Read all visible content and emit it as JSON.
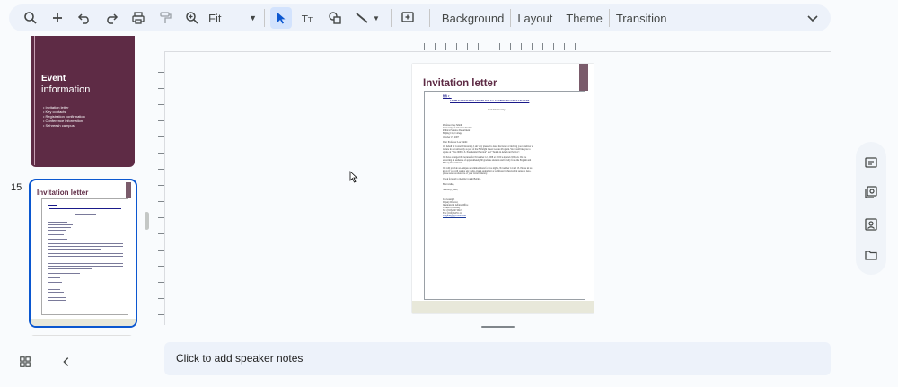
{
  "toolbar": {
    "icons": [
      "search-icon",
      "plus-icon",
      "undo-icon",
      "redo-icon",
      "print-icon",
      "paint-format-icon",
      "zoom-icon"
    ],
    "zoom_value": "Fit",
    "menu": {
      "background": "Background",
      "layout": "Layout",
      "theme": "Theme",
      "transition": "Transition"
    }
  },
  "filmstrip": {
    "previous_slide": {
      "title_bold": "Event",
      "title_light": "information",
      "bullets": [
        "Invitation letter",
        "Key contacts",
        "Registration confirmation",
        "Conference information",
        "Sehreesh campus"
      ]
    },
    "current_slide": {
      "number": "15",
      "title": "Invitation letter"
    }
  },
  "main_slide": {
    "title": "Invitation letter",
    "letter": {
      "lines": [
        {
          "text": "附件 1：",
          "cls": "u"
        },
        {
          "text": "SAMPLE INVITATION LETTER FOR U.S. FULBRIGHT GUEST LECTURE",
          "cls": "u"
        },
        {
          "text": "Cornell University",
          "cls": ""
        },
        {
          "text": "Professor Lee Smith",
          "cls": ""
        },
        {
          "text": "University of American Studies",
          "cls": ""
        },
        {
          "text": "Political Science Department",
          "cls": ""
        },
        {
          "text": "Beijing City College",
          "cls": ""
        },
        {
          "text": "October 15, 2007",
          "cls": ""
        },
        {
          "text": "Dear Professor Lee Smith:",
          "cls": ""
        },
        {
          "text": "On behalf of Cornell University, I am very pleased to issue the honor of inviting you to deliver a",
          "cls": ""
        },
        {
          "text": "lecture in our university as part of the Fulbright Guest Lecture Program. We would like you to",
          "cls": ""
        },
        {
          "text": "speak on \"The 2008 U.S. Presidential Election\" and \"Trends in American Politics\".",
          "cls": ""
        },
        {
          "text": "We have arranged the lectures for November 12, 2008 at 10:00 a.m. and 2:00 p.m. We are",
          "cls": ""
        },
        {
          "text": "expecting an audience of approximately 80 graduate students and faculty from the English and",
          "cls": ""
        },
        {
          "text": "History Departments.",
          "cls": ""
        },
        {
          "text": "We will provide on-campus accommodations for two nights, November 14 and 15. Please let us",
          "cls": ""
        },
        {
          "text": "know if you will require any audio-visual equipment or additional technological support. Also,",
          "cls": ""
        },
        {
          "text": "please send us reference of your travel itinerary.",
          "cls": ""
        },
        {
          "text": "I look forward to meeting you in Beijing.",
          "cls": ""
        },
        {
          "text": "Best wishes,",
          "cls": ""
        },
        {
          "text": "Sincerely yours,",
          "cls": ""
        },
        {
          "text": "Lin Guangyi",
          "cls": ""
        },
        {
          "text": "Deputy Director",
          "cls": ""
        },
        {
          "text": "International Affairs Office",
          "cls": ""
        },
        {
          "text": "Cornell University",
          "cls": ""
        },
        {
          "text": "Tel: (010)26471022",
          "cls": ""
        },
        {
          "text": "Fax: (010)26471111",
          "cls": ""
        },
        {
          "text": "Linguangyi@cornell.edu",
          "cls": "blue"
        }
      ]
    }
  },
  "notes": {
    "placeholder": "Click to add speaker notes"
  },
  "side_panel": {
    "icons": [
      "keep-icon",
      "tasks-icon",
      "contacts-icon",
      "folder-icon"
    ]
  },
  "colors": {
    "accent": "#0b57d0",
    "slide_theme": "#5e2b45",
    "toolbar_bg": "#edf2fa"
  }
}
